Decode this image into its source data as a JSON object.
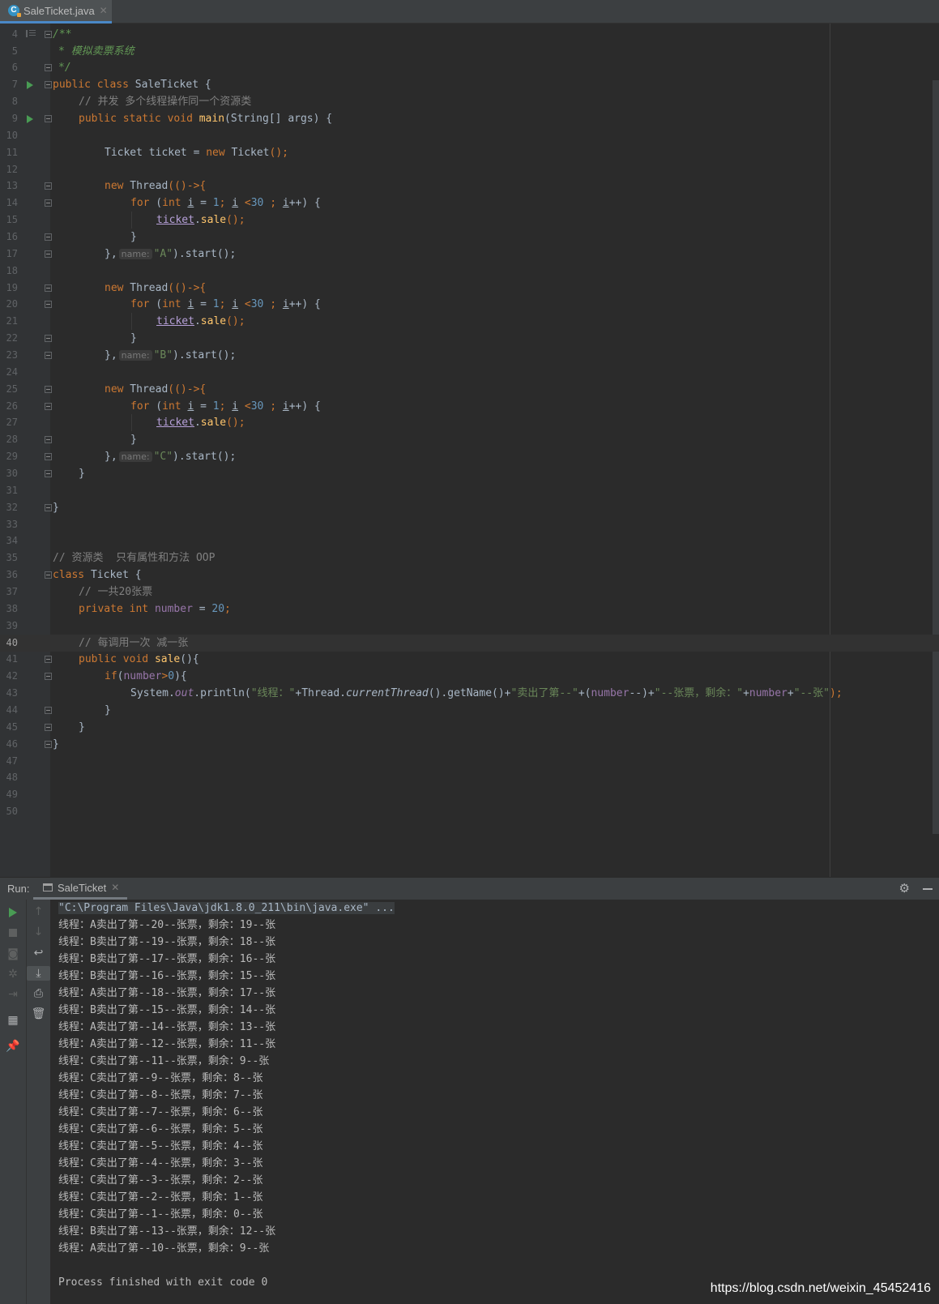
{
  "editor": {
    "file_tab": "SaleTicket.java",
    "current_line": "40"
  },
  "code": {
    "l4": "/**",
    "l5": "* 模拟卖票系统",
    "l6": "*/",
    "l7": "public class SaleTicket {",
    "l8": "// 并发 多个线程操作同一个资源类",
    "l9": "public static void main(String[] args) {",
    "l11": "Ticket ticket = new Ticket();",
    "new_thread": "new Thread(()->{",
    "for_loop": "for (int i = 1; i <30 ; i++) {",
    "sale_call": "ticket.sale();",
    "close_brace": "}",
    "thread_end_pre": "},",
    "param_hint": "name:",
    "thread_end_post": ").start();",
    "thread_names": [
      "\"A\"",
      "\"B\"",
      "\"C\""
    ],
    "l35": "// 资源类  只有属性和方法 OOP",
    "l36": "class Ticket {",
    "l37": "// 一共20张票",
    "l38": "private int number = 20;",
    "l40": "// 每调用一次 减一张",
    "l41": "public void sale(){",
    "l42": "if(number>0){",
    "l43": "System.out.println(\"线程：\"+Thread.currentThread().getName()+\"卖出了第--\"+(number--)+\"--张票，剩余：\"+number+\"--张\");"
  },
  "run": {
    "label": "Run:",
    "tab": "SaleTicket",
    "command": "\"C:\\Program Files\\Java\\jdk1.8.0_211\\bin\\java.exe\" ...",
    "output": [
      "线程：A卖出了第--20--张票，剩余：19--张",
      "线程：B卖出了第--19--张票，剩余：18--张",
      "线程：B卖出了第--17--张票，剩余：16--张",
      "线程：B卖出了第--16--张票，剩余：15--张",
      "线程：A卖出了第--18--张票，剩余：17--张",
      "线程：B卖出了第--15--张票，剩余：14--张",
      "线程：A卖出了第--14--张票，剩余：13--张",
      "线程：A卖出了第--12--张票，剩余：11--张",
      "线程：C卖出了第--11--张票，剩余：9--张",
      "线程：C卖出了第--9--张票，剩余：8--张",
      "线程：C卖出了第--8--张票，剩余：7--张",
      "线程：C卖出了第--7--张票，剩余：6--张",
      "线程：C卖出了第--6--张票，剩余：5--张",
      "线程：C卖出了第--5--张票，剩余：4--张",
      "线程：C卖出了第--4--张票，剩余：3--张",
      "线程：C卖出了第--3--张票，剩余：2--张",
      "线程：C卖出了第--2--张票，剩余：1--张",
      "线程：C卖出了第--1--张票，剩余：0--张",
      "线程：B卖出了第--13--张票，剩余：12--张",
      "线程：A卖出了第--10--张票，剩余：9--张"
    ],
    "exit": "Process finished with exit code 0"
  },
  "watermark": "https://blog.csdn.net/weixin_45452416",
  "colors": {
    "keyword": "#cc7832",
    "string": "#6a8759",
    "number": "#6897bb",
    "comment": "#808080",
    "method": "#ffc66d",
    "field": "#9876aa",
    "run_green": "#499c54"
  }
}
